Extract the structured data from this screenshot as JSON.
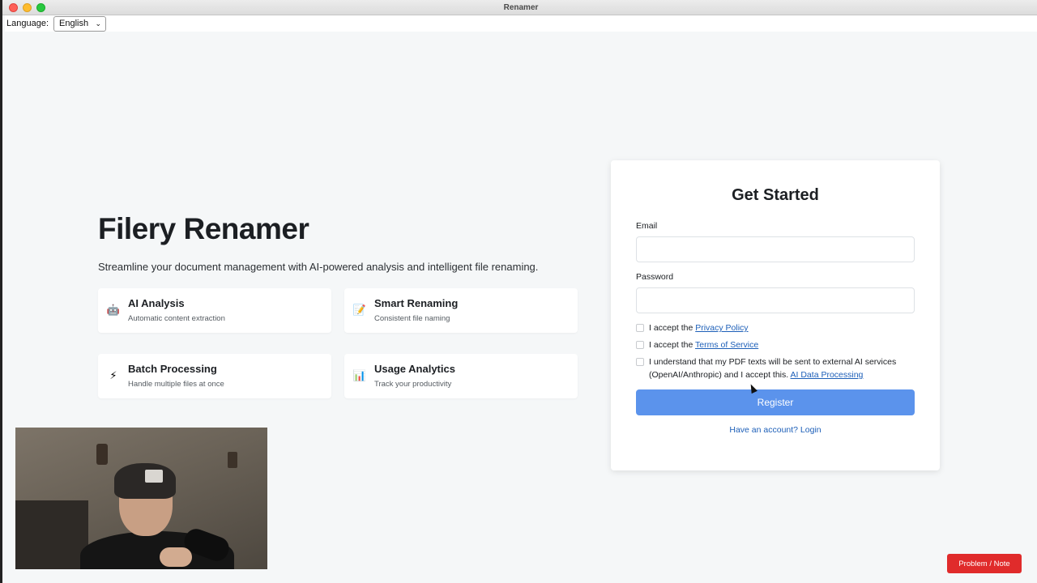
{
  "window": {
    "title": "Renamer"
  },
  "language_bar": {
    "label": "Language:",
    "selected": "English"
  },
  "hero": {
    "title": "Filery Renamer",
    "subtitle": "Streamline your document management with AI-powered analysis and intelligent file renaming."
  },
  "features": [
    {
      "icon": "robot-icon",
      "glyph": "🤖",
      "title": "AI Analysis",
      "description": "Automatic content extraction"
    },
    {
      "icon": "memo-icon",
      "glyph": "📝",
      "title": "Smart Renaming",
      "description": "Consistent file naming"
    },
    {
      "icon": "lightning-icon",
      "glyph": "⚡",
      "title": "Batch Processing",
      "description": "Handle multiple files at once"
    },
    {
      "icon": "bar-chart-icon",
      "glyph": "📊",
      "title": "Usage Analytics",
      "description": "Track your productivity"
    }
  ],
  "register_form": {
    "title": "Get Started",
    "email_label": "Email",
    "email_value": "",
    "password_label": "Password",
    "password_value": "",
    "privacy": {
      "prefix": "I accept the ",
      "link": "Privacy Policy"
    },
    "terms": {
      "prefix": "I accept the ",
      "link": "Terms of Service"
    },
    "ai_consent": {
      "prefix": "I understand that my PDF texts will be sent to external AI services (OpenAI/Anthropic) and I accept this. ",
      "link": "AI Data Processing"
    },
    "submit_label": "Register",
    "login_link": "Have an account? Login"
  },
  "overlay": {
    "problem_button": "Problem / Note"
  },
  "colors": {
    "accent": "#5b93ec",
    "link": "#1d5fb8",
    "alert": "#e02b2b",
    "background": "#f5f7f8"
  }
}
